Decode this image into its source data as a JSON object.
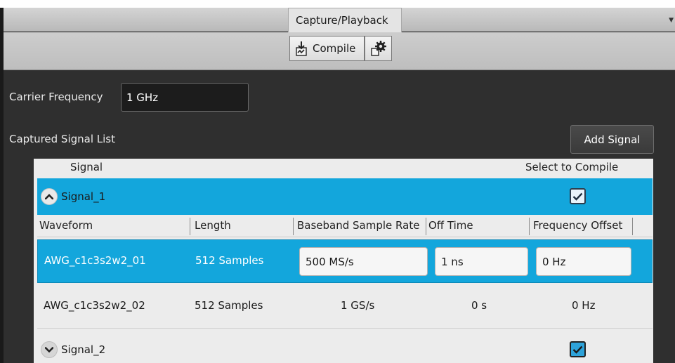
{
  "tabs": {
    "active": "Capture/Playback"
  },
  "toolbar": {
    "compile_label": "Compile"
  },
  "carrier": {
    "label": "Carrier Frequency",
    "value": "1 GHz"
  },
  "signal_list": {
    "label": "Captured Signal List",
    "add_button": "Add Signal"
  },
  "table": {
    "headers": {
      "signal": "Signal",
      "select": "Select to Compile"
    },
    "sub_headers": {
      "waveform": "Waveform",
      "length": "Length",
      "sample_rate": "Baseband Sample Rate",
      "off_time": "Off Time",
      "freq_offset": "Frequency Offset"
    },
    "signals": [
      {
        "name": "Signal_1",
        "expanded": true,
        "selected": true,
        "waveforms": [
          {
            "name": "AWG_c1c3s2w2_01",
            "length": "512 Samples",
            "sample_rate": "500 MS/s",
            "off_time": "1 ns",
            "freq_offset": "0 Hz"
          },
          {
            "name": "AWG_c1c3s2w2_02",
            "length": "512 Samples",
            "sample_rate": "1 GS/s",
            "off_time": "0 s",
            "freq_offset": "0 Hz"
          }
        ]
      },
      {
        "name": "Signal_2",
        "expanded": false,
        "selected": true
      }
    ]
  },
  "colors": {
    "accent": "#13a6dc",
    "panel": "#2f2f2f",
    "table_bg": "#ececec"
  }
}
